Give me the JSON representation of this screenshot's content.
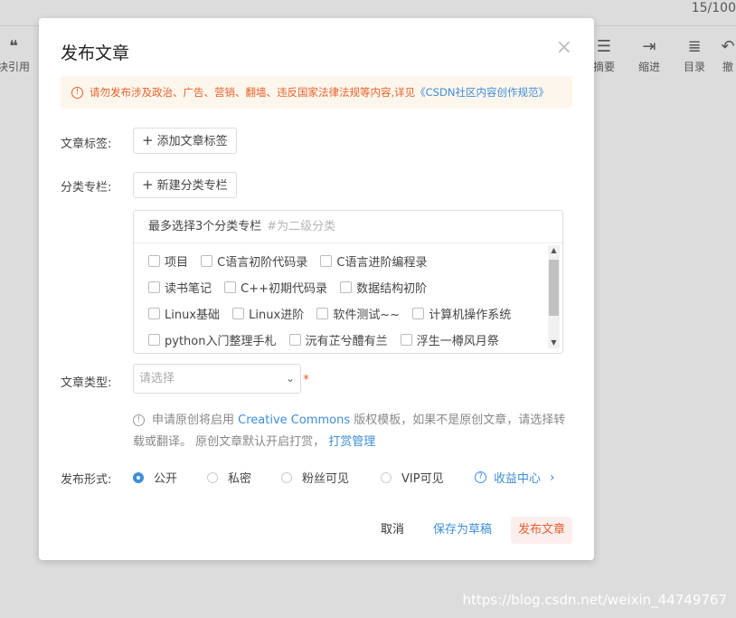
{
  "background": {
    "counter": "15/100",
    "toolbar_left": [
      {
        "icon": "quote-icon",
        "glyph": "❝",
        "label": "块引用"
      }
    ],
    "toolbar_right": [
      {
        "icon": "summary-icon",
        "glyph": "☰",
        "label": "摘要"
      },
      {
        "icon": "indent-icon",
        "glyph": "⇥",
        "label": "缩进"
      },
      {
        "icon": "toc-icon",
        "glyph": "≣",
        "label": "目录"
      },
      {
        "icon": "undo-icon",
        "glyph": "↶",
        "label": "撤"
      }
    ]
  },
  "dialog": {
    "title": "发布文章",
    "close": "×",
    "notice": {
      "text": "请勿发布涉及政治、广告、营销、翻墙、违反国家法律法规等内容,详见",
      "link": "《CSDN社区内容创作规范》"
    },
    "tags": {
      "label": "文章标签:",
      "button": "添加文章标签"
    },
    "category": {
      "label": "分类专栏:",
      "button": "新建分类专栏",
      "header": "最多选择3个分类专栏",
      "hint": "#为二级分类",
      "rows": [
        [
          "项目",
          "C语言初阶代码录",
          "C语言进阶编程录"
        ],
        [
          "读书笔记",
          "C++初期代码录",
          "数据结构初阶"
        ],
        [
          "Linux基础",
          "Linux进阶",
          "软件测试~~",
          "计算机操作系统"
        ],
        [
          "python入门整理手札",
          "沅有芷兮醴有兰",
          "浮生一樽风月祭"
        ]
      ]
    },
    "article_type": {
      "label": "文章类型:",
      "placeholder": "请选择",
      "required": "*"
    },
    "info": {
      "text1": "申请原创将启用",
      "link1": "Creative Commons",
      "text2": "版权模板，如果不是原创文章，请选择转载或翻译。 原创文章默认开启打赏，",
      "link2": "打赏管理"
    },
    "publish_form": {
      "label": "发布形式:",
      "options": [
        "公开",
        "私密",
        "粉丝可见",
        "VIP可见"
      ],
      "selected": "公开",
      "income": "收益中心"
    },
    "footer": {
      "cancel": "取消",
      "draft": "保存为草稿",
      "publish": "发布文章"
    }
  },
  "watermark": "https://blog.csdn.net/weixin_44749767",
  "colors": {
    "accent": "#3e8ed8",
    "warning": "#e6622c",
    "notice_bg": "#fdf6ec"
  }
}
